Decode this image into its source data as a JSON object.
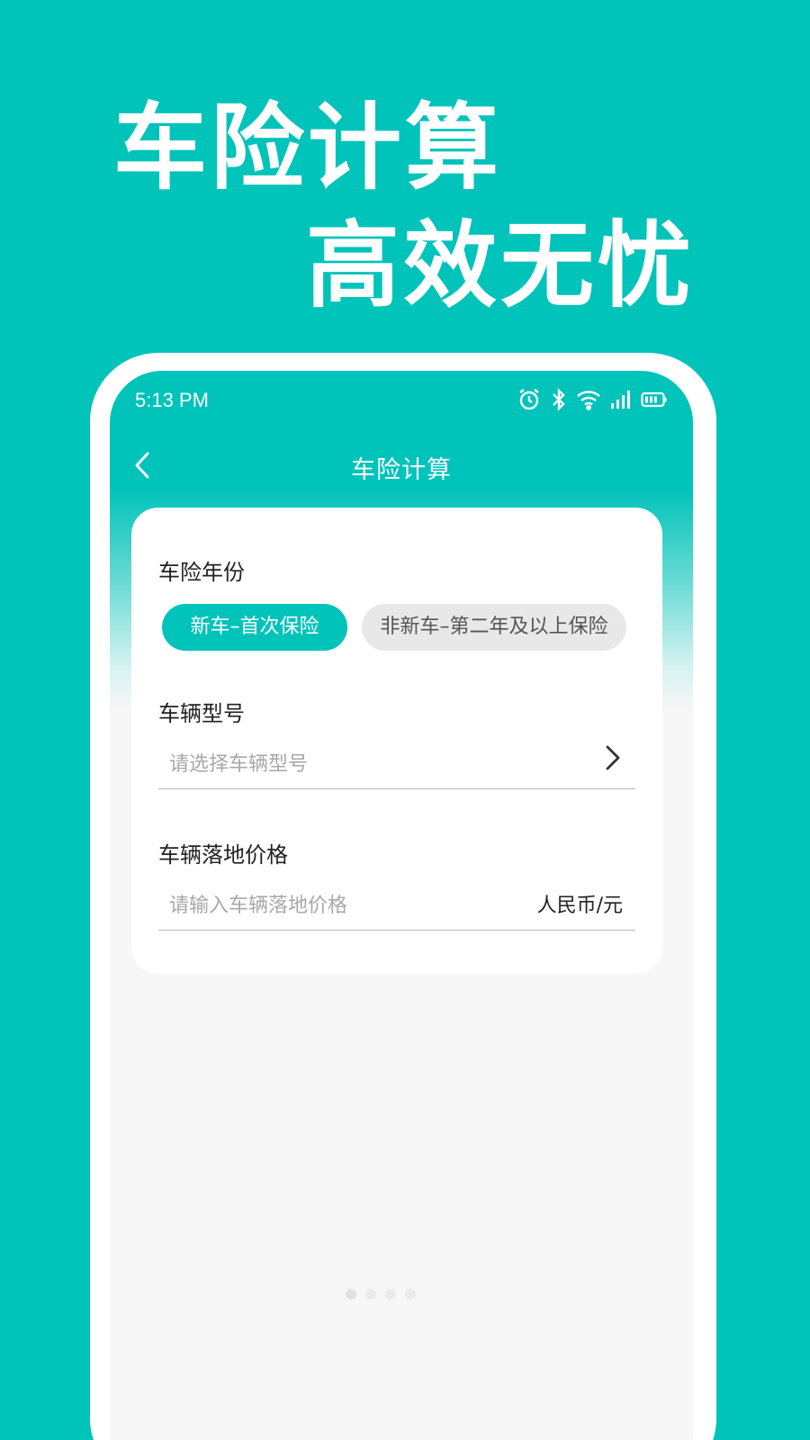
{
  "promo": {
    "headline_line1": "车险计算",
    "headline_line2": "高效无忧"
  },
  "status_bar": {
    "time": "5:13 PM",
    "icons": [
      "alarm-icon",
      "bluetooth-icon",
      "wifi-icon",
      "signal-icon",
      "battery-icon"
    ]
  },
  "nav": {
    "title": "车险计算",
    "back_icon": "chevron-left-icon"
  },
  "form": {
    "insurance_year": {
      "label": "车险年份",
      "options": [
        "新车–首次保险",
        "非新车–第二年及以上保险"
      ],
      "selected": "新车–首次保险"
    },
    "vehicle_model": {
      "label": "车辆型号",
      "placeholder": "请选择车辆型号"
    },
    "vehicle_price": {
      "label": "车辆落地价格",
      "placeholder": "请输入车辆落地价格",
      "unit": "人民币/元"
    }
  },
  "colors": {
    "brand": "#00c3ba",
    "chip_inactive_bg": "#e8e8e8",
    "page_bg": "#f7f7f7"
  }
}
